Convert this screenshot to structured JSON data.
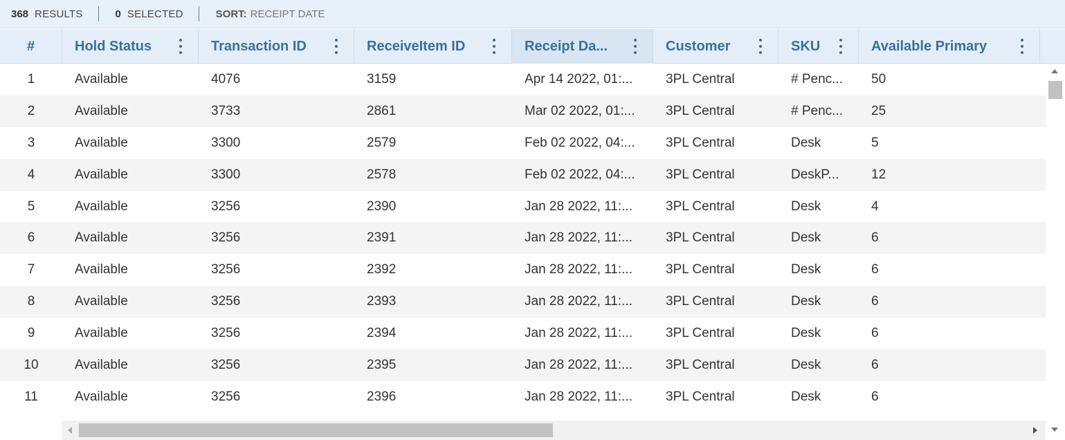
{
  "summary": {
    "results_count": "368",
    "results_label": "RESULTS",
    "selected_count": "0",
    "selected_label": "SELECTED",
    "sort_label": "SORT:",
    "sort_value": "RECEIPT DATE"
  },
  "columns": [
    {
      "label": "#",
      "menu": false
    },
    {
      "label": "Hold Status",
      "menu": true
    },
    {
      "label": "Transaction ID",
      "menu": true
    },
    {
      "label": "ReceiveItem ID",
      "menu": true
    },
    {
      "label": "Receipt Da...",
      "menu": true,
      "sorted": true
    },
    {
      "label": "Customer",
      "menu": true
    },
    {
      "label": "SKU",
      "menu": true
    },
    {
      "label": "Available Primary",
      "menu": true
    }
  ],
  "rows": [
    [
      "1",
      "Available",
      "4076",
      "3159",
      "Apr 14 2022, 01:...",
      "3PL Central",
      "# Penc...",
      "50"
    ],
    [
      "2",
      "Available",
      "3733",
      "2861",
      "Mar 02 2022, 01:...",
      "3PL Central",
      "# Penc...",
      "25"
    ],
    [
      "3",
      "Available",
      "3300",
      "2579",
      "Feb 02 2022, 04:...",
      "3PL Central",
      "Desk",
      "5"
    ],
    [
      "4",
      "Available",
      "3300",
      "2578",
      "Feb 02 2022, 04:...",
      "3PL Central",
      "DeskP...",
      "12"
    ],
    [
      "5",
      "Available",
      "3256",
      "2390",
      "Jan 28 2022, 11:...",
      "3PL Central",
      "Desk",
      "4"
    ],
    [
      "6",
      "Available",
      "3256",
      "2391",
      "Jan 28 2022, 11:...",
      "3PL Central",
      "Desk",
      "6"
    ],
    [
      "7",
      "Available",
      "3256",
      "2392",
      "Jan 28 2022, 11:...",
      "3PL Central",
      "Desk",
      "6"
    ],
    [
      "8",
      "Available",
      "3256",
      "2393",
      "Jan 28 2022, 11:...",
      "3PL Central",
      "Desk",
      "6"
    ],
    [
      "9",
      "Available",
      "3256",
      "2394",
      "Jan 28 2022, 11:...",
      "3PL Central",
      "Desk",
      "6"
    ],
    [
      "10",
      "Available",
      "3256",
      "2395",
      "Jan 28 2022, 11:...",
      "3PL Central",
      "Desk",
      "6"
    ],
    [
      "11",
      "Available",
      "3256",
      "2396",
      "Jan 28 2022, 11:...",
      "3PL Central",
      "Desk",
      "6"
    ]
  ],
  "colors": {
    "summary_bg": "#e7f1fa",
    "header_bg": "#e3eef8",
    "header_text": "#3c6f9a",
    "row_alt_bg": "#f4f4f4"
  }
}
